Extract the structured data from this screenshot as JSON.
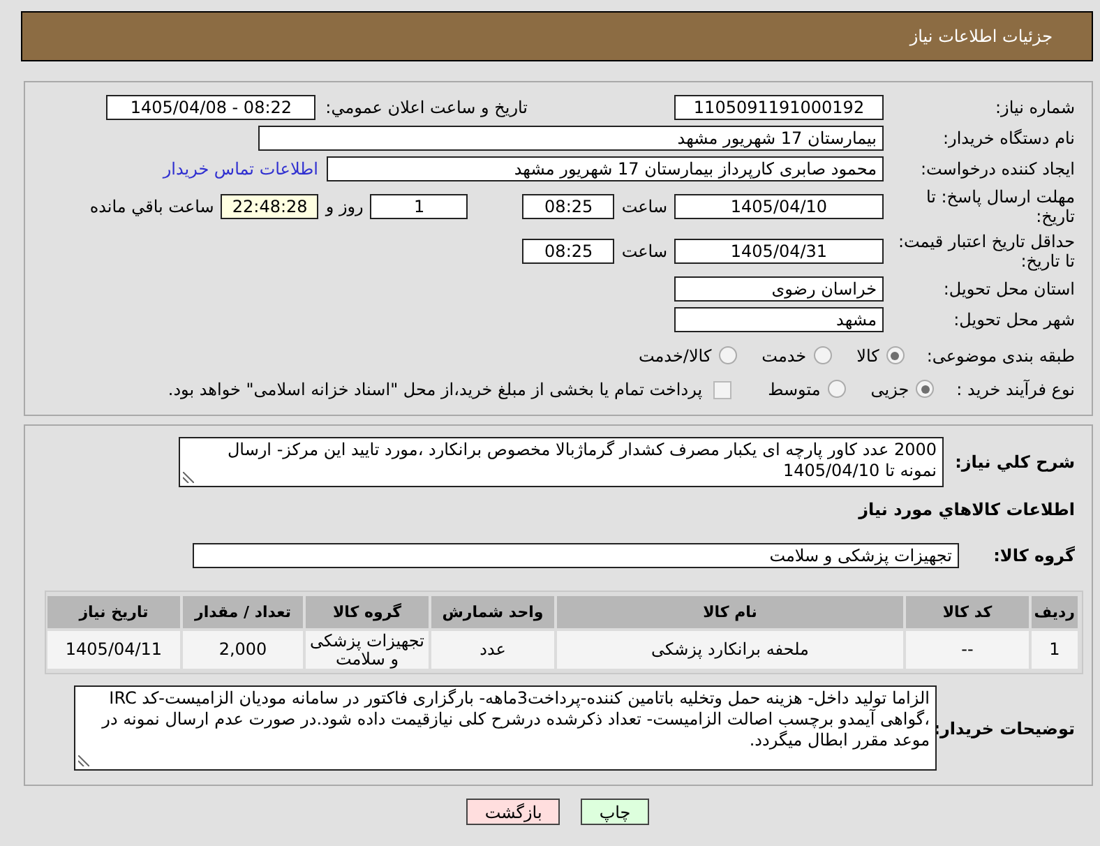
{
  "header": {
    "title": "جزئیات اطلاعات نیاز"
  },
  "need_info": {
    "need_number": {
      "label": "شماره نیاز:",
      "value": "1105091191000192"
    },
    "public_announcement": {
      "label": "تاريخ و ساعت اعلان عمومي:",
      "value": "1405/04/08 - 08:22"
    },
    "buyer_organization": {
      "label": "نام دستگاه خریدار:",
      "value": "بیمارستان 17 شهریور مشهد"
    },
    "requester": {
      "label": "ایجاد کننده درخواست:",
      "value": "محمود صابری کارپرداز بیمارستان 17 شهریور مشهد",
      "contact_link": "اطلاعات تماس خریدار"
    },
    "response_deadline": {
      "label": "مهلت ارسال پاسخ: تا تاریخ:",
      "date": "1405/04/10",
      "time_label": "ساعت",
      "time": "08:25",
      "days": "1",
      "days_label": "روز و",
      "remaining_time": "22:48:28",
      "remaining_label": "ساعت باقي مانده"
    },
    "price_validity": {
      "label": "حداقل تاریخ اعتبار قیمت: تا تاریخ:",
      "date": "1405/04/31",
      "time_label": "ساعت",
      "time": "08:25"
    },
    "delivery_province": {
      "label": "استان محل تحویل:",
      "value": "خراسان رضوی"
    },
    "delivery_city": {
      "label": "شهر محل تحویل:",
      "value": "مشهد"
    },
    "subject_category": {
      "label": "طبقه بندی موضوعی:",
      "options": [
        {
          "label": "کالا",
          "selected": true,
          "disabled": true
        },
        {
          "label": "خدمت",
          "selected": false,
          "disabled": true
        },
        {
          "label": "کالا/خدمت",
          "selected": false,
          "disabled": true
        }
      ]
    },
    "purchase_process": {
      "label": "نوع فرآیند خرید :",
      "options": [
        {
          "label": "جزیی",
          "selected": true,
          "disabled": true
        },
        {
          "label": "متوسط",
          "selected": false,
          "disabled": true
        }
      ],
      "treasury_payment": {
        "label": "پرداخت تمام یا بخشی از مبلغ خرید،از محل \"اسناد خزانه اسلامی\" خواهد بود.",
        "checked": false,
        "disabled": true
      }
    }
  },
  "need_details": {
    "description": {
      "label": "شرح کلي نیاز:",
      "value": "2000 عدد کاور پارچه ای یکبار مصرف کشدار گرماژبالا مخصوص برانکارد ،مورد تایید این مرکز- ارسال نمونه تا 1405/04/10"
    },
    "goods_title": "اطلاعات کالاهاي مورد نیاز",
    "goods_group": {
      "label": "گروه کالا:",
      "value": "تجهیزات پزشکی و سلامت"
    },
    "table": {
      "columns": [
        "ردیف",
        "کد کالا",
        "نام کالا",
        "واحد شمارش",
        "گروه کالا",
        "تعداد / مقدار",
        "تاریخ نیاز"
      ],
      "rows": [
        [
          "1",
          "--",
          "ملحفه برانکارد پزشکی",
          "عدد",
          "تجهیزات پزشکی و سلامت",
          "2,000",
          "1405/04/11"
        ]
      ]
    },
    "buyer_notes": {
      "label": "توضیحات خریدار:",
      "value": "الزاما تولید داخل- هزینه حمل وتخلیه باتامین کننده-پرداخت3ماهه- بارگزاری فاکتور در سامانه مودیان الزامیست-کد IRC ،گواهی آیمدو برچسب اصالت الزامیست- تعداد ذکرشده درشرح کلی نیازقیمت داده شود.در صورت عدم ارسال نمونه در موعد مقرر ابطال میگردد."
    }
  },
  "buttons": [
    {
      "label": "چاپ",
      "kind": "print"
    },
    {
      "label": "بازگشت",
      "kind": "back"
    }
  ]
}
